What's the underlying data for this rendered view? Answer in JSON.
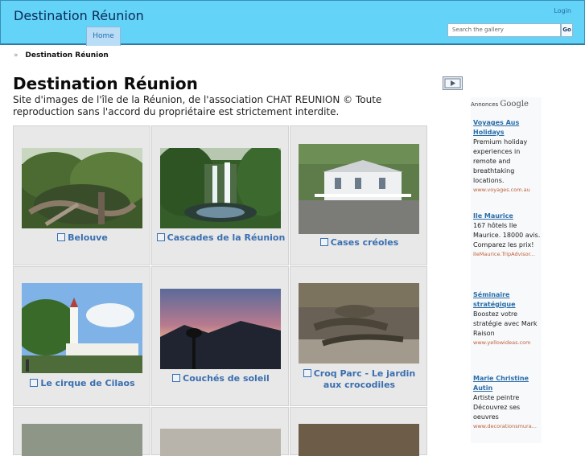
{
  "header": {
    "site_title": "Destination Réunion",
    "login": "Login",
    "tab_home": "Home",
    "search_placeholder": "Search the gallery",
    "search_go": "Go"
  },
  "breadcrumb": {
    "separator": "»",
    "current": "Destination Réunion"
  },
  "page": {
    "title": "Destination Réunion",
    "description": "Site d'images de l'île de la Réunion, de l'association CHAT REUNION © Toute reproduction sans l'accord du propriétaire est strictement interdite."
  },
  "gallery": [
    {
      "caption": "Belouve"
    },
    {
      "caption": "Cascades de la Réunion"
    },
    {
      "caption": "Cases créoles"
    },
    {
      "caption": "Le cirque de Cilaos"
    },
    {
      "caption": "Couchés de soleil"
    },
    {
      "caption": "Croq Parc - Le jardin aux crocodiles"
    }
  ],
  "ads": {
    "label": "Annonces",
    "brand": "Google",
    "items": [
      {
        "title": "Voyages Aus Holidays",
        "text": "Premium holiday experiences in remote and breathtaking locations.",
        "url": "www.voyages.com.au"
      },
      {
        "title": "Ile Maurice",
        "text": "167 hôtels Ile Maurice. 18000 avis. Comparez les prix!",
        "url": "IleMaurice.TripAdvisor..."
      },
      {
        "title": "Séminaire stratégique",
        "text": "Boostez votre stratégie avec Mark Raison",
        "url": "www.yellowideas.com"
      },
      {
        "title": "Marie Christine Autin",
        "text": "Artiste peintre Découvrez ses oeuvres",
        "url": "www.decorationsmura..."
      }
    ]
  }
}
